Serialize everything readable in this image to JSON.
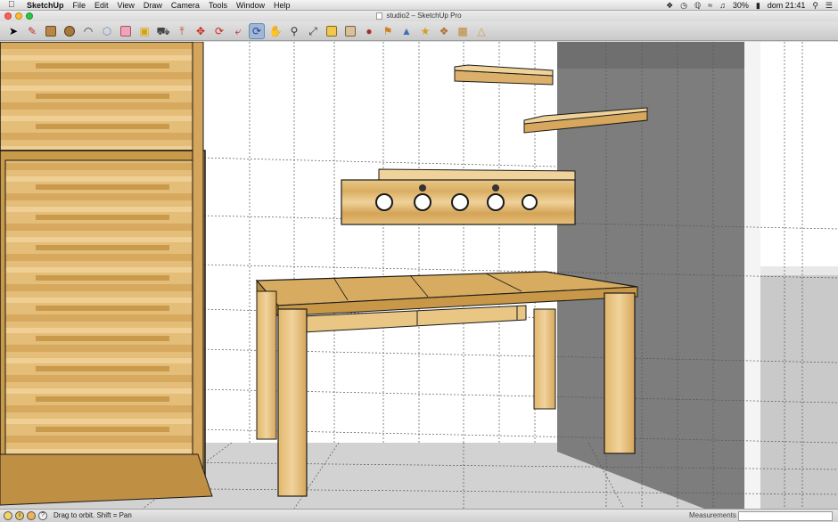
{
  "menubar": {
    "apple_icon": "apple-logo-icon",
    "app_name": "SketchUp",
    "menus": [
      "File",
      "Edit",
      "View",
      "Draw",
      "Camera",
      "Tools",
      "Window",
      "Help"
    ],
    "battery": "30%",
    "clock": "dom 21:41"
  },
  "window": {
    "title": "studio2 – SketchUp Pro",
    "traffic_light_colors": [
      "#ff5f57",
      "#febc2e",
      "#28c840"
    ]
  },
  "toolbar": {
    "tools": [
      {
        "name": "select",
        "icon": "arrow-select-icon"
      },
      {
        "name": "pencil",
        "icon": "pencil-icon"
      },
      {
        "name": "rectangle",
        "icon": "rectangle-icon"
      },
      {
        "name": "circle",
        "icon": "circle-icon"
      },
      {
        "name": "arc",
        "icon": "arc-icon"
      },
      {
        "name": "make-component",
        "icon": "component-icon"
      },
      {
        "name": "eraser",
        "icon": "eraser-icon"
      },
      {
        "name": "tape-measure",
        "icon": "tape-measure-icon"
      },
      {
        "name": "paint-bucket",
        "icon": "paint-bucket-icon"
      },
      {
        "name": "push-pull",
        "icon": "push-pull-icon"
      },
      {
        "name": "move",
        "icon": "move-icon"
      },
      {
        "name": "rotate",
        "icon": "rotate-icon"
      },
      {
        "name": "follow-me",
        "icon": "follow-me-icon"
      },
      {
        "name": "orbit",
        "icon": "orbit-icon",
        "active": true
      },
      {
        "name": "pan",
        "icon": "pan-hand-icon"
      },
      {
        "name": "zoom",
        "icon": "zoom-icon"
      },
      {
        "name": "zoom-extents",
        "icon": "zoom-extents-icon"
      },
      {
        "name": "previous-view",
        "icon": "previous-view-icon"
      },
      {
        "name": "warehouse",
        "icon": "warehouse-icon"
      },
      {
        "name": "share-model",
        "icon": "share-model-icon"
      },
      {
        "name": "get-models",
        "icon": "get-models-icon"
      },
      {
        "name": "extension-warehouse",
        "icon": "extension-warehouse-icon"
      },
      {
        "name": "layout",
        "icon": "layout-icon"
      },
      {
        "name": "components-browser",
        "icon": "components-browser-icon"
      },
      {
        "name": "styles",
        "icon": "styles-icon"
      },
      {
        "name": "iso-view",
        "icon": "iso-view-icon"
      }
    ]
  },
  "scene": {
    "description_icon": "3d-model-viewport",
    "colors": {
      "wood_light": "#e8c47e",
      "wood_dark": "#c99a4a",
      "wall_grey": "#7c7c7c",
      "floor": "#cfcfcf",
      "edge": "#1a1a1a"
    }
  },
  "statusbar": {
    "hint": "Drag to orbit.  Shift = Pan",
    "measurements_label": "Measurements",
    "measurements_value": ""
  }
}
